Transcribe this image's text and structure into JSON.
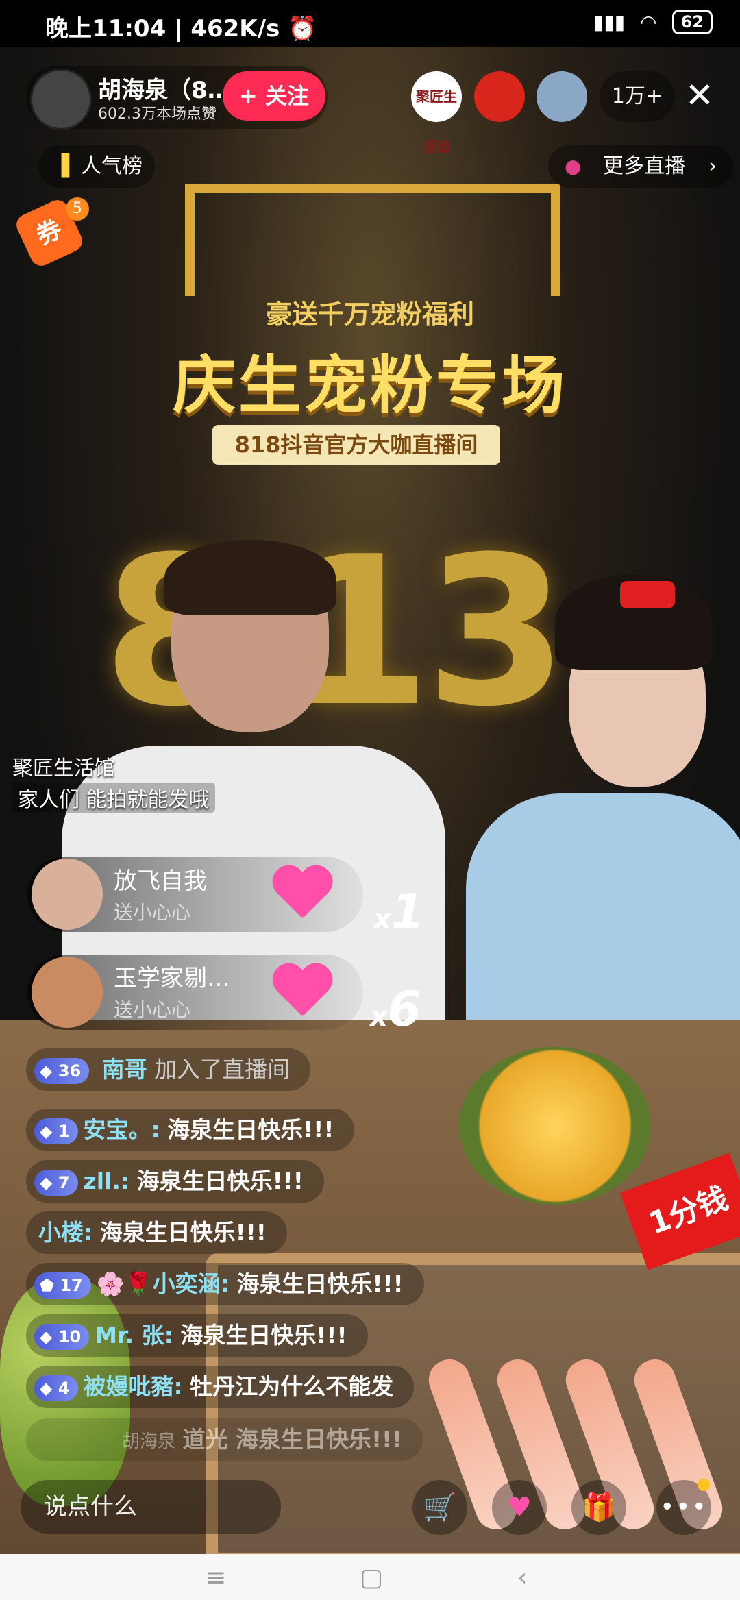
{
  "status_bar": {
    "time": "晚上11:04",
    "speed": "462K/s",
    "battery": "62"
  },
  "banner": {
    "subtitle": "豪送千万宠粉福利",
    "main": "庆生宠粉专场",
    "tag": "818抖音官方大咖直播间",
    "numbers": [
      "8",
      "1",
      "3"
    ]
  },
  "anchor": {
    "name": "胡海泉（8…",
    "likes": "602.3万本场点赞",
    "follow_label": "+ 关注"
  },
  "viewers": {
    "shop_badge": "聚匠生活馆",
    "count": "1万+"
  },
  "top_pills": {
    "rank": "人气榜",
    "more_live": "更多直播"
  },
  "coupon": {
    "label": "券",
    "badge": "5"
  },
  "shop": {
    "name": "聚匠生活馆",
    "message": "家人们 能拍就能发哦"
  },
  "gifts": [
    {
      "user": "放飞自我",
      "action": "送小心心",
      "combo": "1"
    },
    {
      "user": "玉学家剔…",
      "action": "送小心心",
      "combo": "6"
    }
  ],
  "join_notice": {
    "level": "36",
    "user": "南哥",
    "text": "加入了直播间"
  },
  "comments": [
    {
      "level": "1",
      "user": "安宝。:",
      "text": "海泉生日快乐!!!"
    },
    {
      "level": "7",
      "user": "zll.:",
      "text": "海泉生日快乐!!!"
    },
    {
      "level": "",
      "user": "小楼:",
      "text": "海泉生日快乐!!!"
    },
    {
      "level": "17",
      "user": "🌸🌹小奕涵:",
      "text": "海泉生日快乐!!!"
    },
    {
      "level": "10",
      "user": "Mr. 张:",
      "text": "海泉生日快乐!!!"
    },
    {
      "level": "4",
      "user": "被嫚吡豬:",
      "text": "牡丹江为什么不能发"
    },
    {
      "level": "",
      "user": "胡海泉",
      "text": "道光 海泉生日快乐!!!"
    }
  ],
  "price_tag": "1分钱",
  "bottom": {
    "input_placeholder": "说点什么"
  }
}
